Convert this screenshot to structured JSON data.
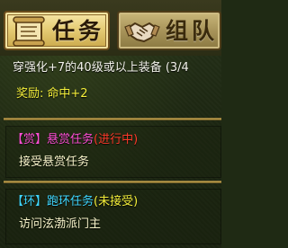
{
  "tabs": [
    {
      "label": "任务",
      "icon": "scroll-icon",
      "active": true
    },
    {
      "label": "组队",
      "icon": "handshake-icon",
      "active": false
    }
  ],
  "current_task": {
    "requirement": "穿强化+7的40级或以上装备 (3/4",
    "reward_label": "奖励:",
    "reward_value": "命中+2"
  },
  "bounty_task": {
    "tag": "【赏】",
    "name": "悬赏任务",
    "status": "(进行中)",
    "description": "接受悬赏任务"
  },
  "loop_task": {
    "tag": "【环】",
    "name": "跑环任务",
    "status": "(未接受)",
    "description": "访问泫渤派门主"
  },
  "colors": {
    "magenta": "#ff4fd6",
    "cyan": "#3fd7ff",
    "red_status": "#ff3b2a",
    "yellow": "#f4ef3a"
  }
}
